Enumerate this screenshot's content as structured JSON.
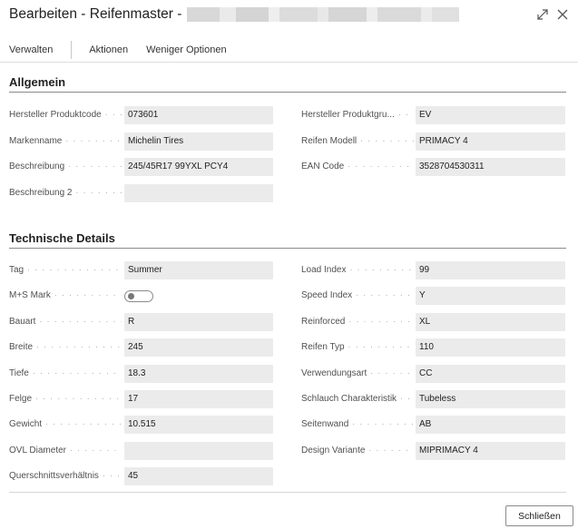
{
  "window": {
    "title": "Bearbeiten - Reifenmaster -",
    "expand_icon": "expand-icon",
    "close_icon": "close-icon"
  },
  "actions": {
    "manage": "Verwalten",
    "actions": "Aktionen",
    "fewer_options": "Weniger Optionen"
  },
  "general": {
    "title": "Allgemein",
    "left": [
      {
        "label": "Hersteller Produktcode",
        "value": "073601"
      },
      {
        "label": "Markenname",
        "value": "Michelin Tires"
      },
      {
        "label": "Beschreibung",
        "value": "245/45R17 99YXL PCY4"
      },
      {
        "label": "Beschreibung 2",
        "value": ""
      }
    ],
    "right": [
      {
        "label": "Hersteller Produktgru...",
        "value": "EV"
      },
      {
        "label": "Reifen Modell",
        "value": "PRIMACY 4"
      },
      {
        "label": "EAN Code",
        "value": "3528704530311"
      }
    ]
  },
  "technical": {
    "title": "Technische Details",
    "left": [
      {
        "label": "Tag",
        "value": "Summer"
      },
      {
        "label": "M+S Mark",
        "value": "",
        "toggle": true,
        "checked": false
      },
      {
        "label": "Bauart",
        "value": "R"
      },
      {
        "label": "Breite",
        "value": "245"
      },
      {
        "label": "Tiefe",
        "value": "18.3"
      },
      {
        "label": "Felge",
        "value": "17"
      },
      {
        "label": "Gewicht",
        "value": "10.515"
      },
      {
        "label": "OVL Diameter",
        "value": ""
      },
      {
        "label": "Querschnittsverhältnis",
        "value": "45"
      }
    ],
    "right": [
      {
        "label": "Load Index",
        "value": "99"
      },
      {
        "label": "Speed Index",
        "value": "Y"
      },
      {
        "label": "Reinforced",
        "value": "XL"
      },
      {
        "label": "Reifen Typ",
        "value": "110"
      },
      {
        "label": "Verwendungsart",
        "value": "CC"
      },
      {
        "label": "Schlauch Charakteristik",
        "value": "Tubeless"
      },
      {
        "label": "Seitenwand",
        "value": "AB"
      },
      {
        "label": "Design Variante",
        "value": "MIPRIMACY 4"
      }
    ]
  },
  "footer": {
    "close_label": "Schließen"
  }
}
